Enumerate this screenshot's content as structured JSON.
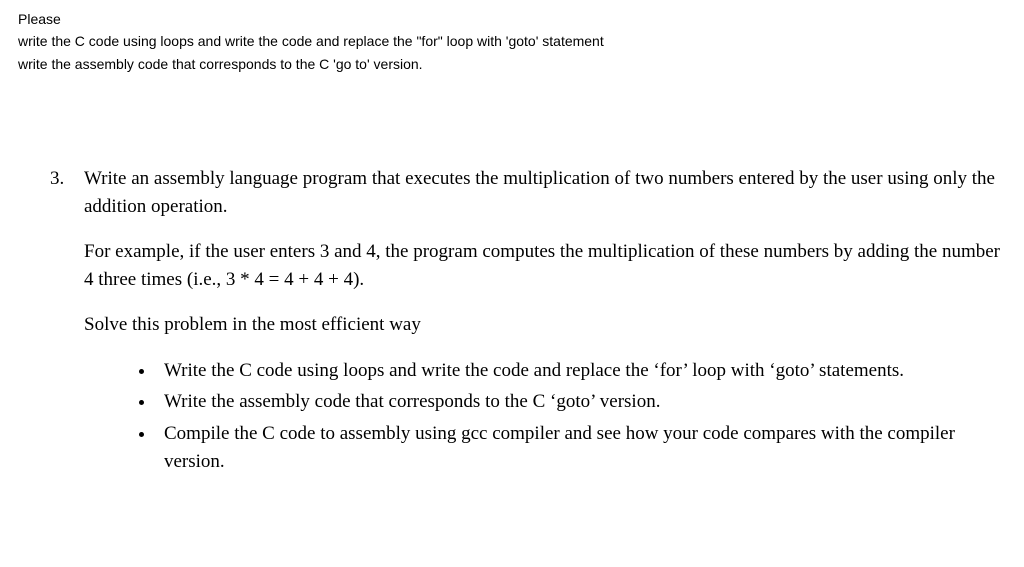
{
  "header": {
    "line1": "Please",
    "line2": "write the C code using loops and write the code and replace the \"for\" loop with 'goto' statement",
    "line3": "write the assembly code that corresponds to the C 'go to' version."
  },
  "question": {
    "number": "3.",
    "intro": "Write an assembly language program that executes the multiplication of two numbers entered by the user using only the addition operation.",
    "example": "For example, if the user enters 3 and 4, the program computes the multiplication of these numbers by adding the number 4 three times (i.e., 3 * 4 =  4 + 4 + 4).",
    "solve": "Solve this problem in the most efficient way",
    "bullets": [
      "Write the C code using loops and write the code and replace the ‘for’ loop with ‘goto’ statements.",
      "Write the assembly code that corresponds to the C ‘goto’ version.",
      "Compile the C code to assembly using gcc compiler and see how your code compares with the compiler version."
    ]
  }
}
